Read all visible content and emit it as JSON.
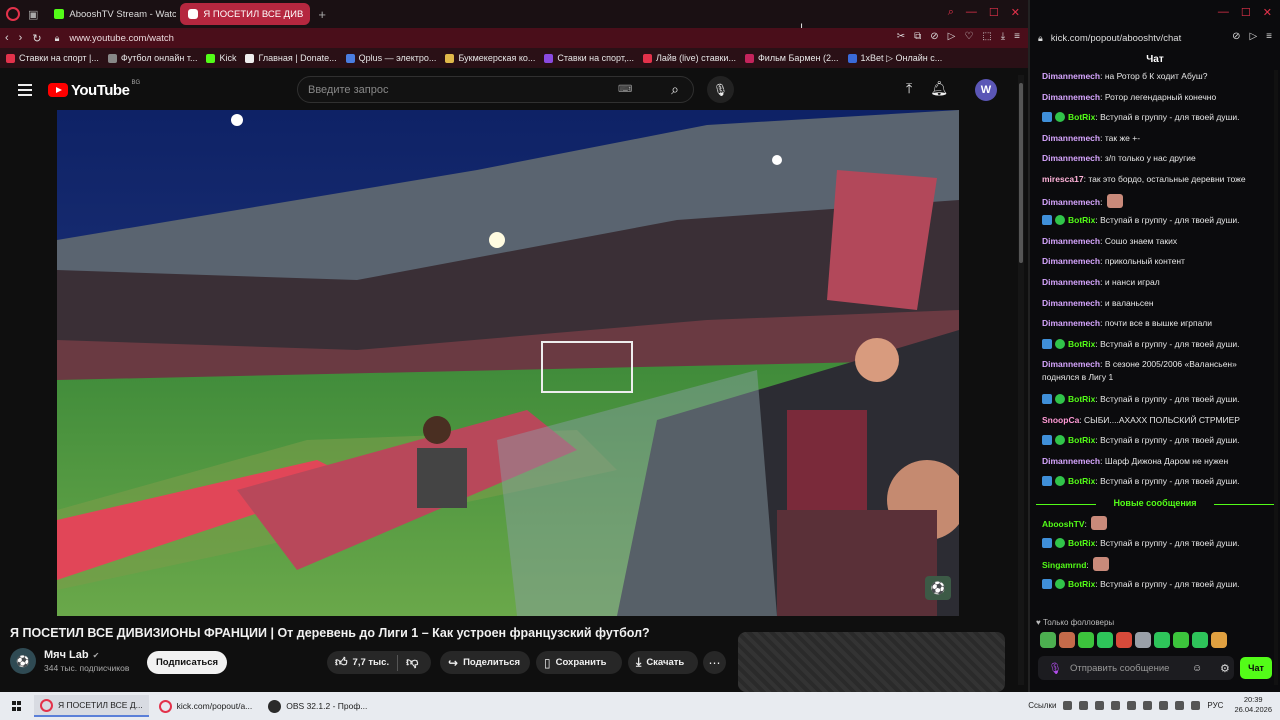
{
  "browser": {
    "tabs": [
      {
        "label": "AbooshTV Stream - Watch",
        "active": false,
        "color": "#53fc18"
      },
      {
        "label": "Я ПОСЕТИЛ ВСЕ ДИВ",
        "active": true,
        "color": "#ff0000"
      }
    ],
    "url": "www.youtube.com/watch",
    "bookmarks": [
      {
        "label": "Ставки на спорт |...",
        "color": "#e3324b"
      },
      {
        "label": "Футбол онлайн т...",
        "color": "#888888"
      },
      {
        "label": "Kick",
        "color": "#53fc18"
      },
      {
        "label": "Главная | Donate...",
        "color": "#eeeeee"
      },
      {
        "label": "Qplus — электро...",
        "color": "#4a7de0"
      },
      {
        "label": "Букмекерская ко...",
        "color": "#e0b84a"
      },
      {
        "label": "Ставки на спорт,...",
        "color": "#8a4ae0"
      },
      {
        "label": "Лайв (live) ставки...",
        "color": "#e3324b"
      },
      {
        "label": "Фильм Бармен (2...",
        "color": "#c4245c"
      },
      {
        "label": "1xBet ▷ Онлайн с...",
        "color": "#3a6ad8"
      }
    ]
  },
  "youtube": {
    "logo_text": "YouTube",
    "country_code": "BG",
    "search_placeholder": "Введите запрос",
    "avatar_letter": "W",
    "video_title": "Я ПОСЕТИЛ ВСЕ ДИВИЗИОНЫ ФРАНЦИИ | От деревень до Лиги 1 – Как устроен французский футбол?",
    "channel_name": "Мяч Lab",
    "channel_subs": "344 тыс. подписчиков",
    "subscribe_label": "Подписаться",
    "likes": "7,7 тыс.",
    "share_label": "Поделиться",
    "save_label": "Сохранить",
    "download_label": "Скачать"
  },
  "kick": {
    "url": "kick.com/popout/abooshtv/chat",
    "chat_title": "Чат",
    "messages": [
      {
        "user": "Dimannemech",
        "color": "#d7a6ff",
        "text": "на Ротор б К ходит Абуш?",
        "badges": false
      },
      {
        "user": "Dimannemech",
        "color": "#d7a6ff",
        "text": "Ротор легендарный конечно",
        "badges": false
      },
      {
        "user": "BotRix",
        "color": "#53fc18",
        "text": "Вступай в группу - для твоей души.",
        "badges": true
      },
      {
        "user": "Dimannemech",
        "color": "#d7a6ff",
        "text": "так же +-",
        "badges": false
      },
      {
        "user": "Dimannemech",
        "color": "#d7a6ff",
        "text": "з/п только у нас другие",
        "badges": false
      },
      {
        "user": "miresca17",
        "color": "#ffb3d9",
        "text": "так это бордо, остальные деревни тоже",
        "badges": false
      },
      {
        "user": "Dimannemech",
        "color": "#d7a6ff",
        "text": "",
        "badges": false
      },
      {
        "user": "BotRix",
        "color": "#53fc18",
        "text": "Вступай в группу - для твоей души.",
        "badges": true
      },
      {
        "user": "Dimannemech",
        "color": "#d7a6ff",
        "text": "Сошо знаем таких",
        "badges": false
      },
      {
        "user": "Dimannemech",
        "color": "#d7a6ff",
        "text": "прикольный контент",
        "badges": false
      },
      {
        "user": "Dimannemech",
        "color": "#d7a6ff",
        "text": "и нанси играл",
        "badges": false
      },
      {
        "user": "Dimannemech",
        "color": "#d7a6ff",
        "text": "и валаньсен",
        "badges": false
      },
      {
        "user": "Dimannemech",
        "color": "#d7a6ff",
        "text": "почти все в вышке игрпали",
        "badges": false
      },
      {
        "user": "BotRix",
        "color": "#53fc18",
        "text": "Вступай в группу - для твоей души.",
        "badges": true
      },
      {
        "user": "Dimannemech",
        "color": "#d7a6ff",
        "text": "В сезоне 2005/2006 «Валансьен» поднялся в Лигу 1",
        "badges": false
      },
      {
        "user": "BotRix",
        "color": "#53fc18",
        "text": "Вступай в группу - для твоей души.",
        "badges": true
      },
      {
        "user": "SnoopCa",
        "color": "#ff9ad5",
        "text": "СЫБИ....АХАХХ ПОЛЬСКИЙ СТРМИЕР",
        "badges": false
      },
      {
        "user": "BotRix",
        "color": "#53fc18",
        "text": "Вступай в группу - для твоей души.",
        "badges": true
      },
      {
        "user": "Dimannemech",
        "color": "#d7a6ff",
        "text": "Шарф Дижона Даром не нужен",
        "badges": false
      },
      {
        "user": "BotRix",
        "color": "#53fc18",
        "text": "Вступай в группу - для твоей души.",
        "badges": true
      }
    ],
    "new_messages_label": "Новые сообщения",
    "new_messages": [
      {
        "user": "AbooshTV",
        "color": "#53fc18",
        "text": "",
        "badges": false
      },
      {
        "user": "BotRix",
        "color": "#53fc18",
        "text": "Вступай в группу - для твоей души.",
        "badges": true
      },
      {
        "user": "Singamrnd",
        "color": "#53fc18",
        "text": "",
        "badges": false
      },
      {
        "user": "BotRix",
        "color": "#53fc18",
        "text": "Вступай в группу - для твоей души.",
        "badges": true
      }
    ],
    "followers_label": "Только фолловеры",
    "input_placeholder": "Отправить сообщение",
    "send_label": "Чат"
  },
  "taskbar": {
    "items": [
      {
        "label": "Я ПОСЕТИЛ ВСЕ Д..."
      },
      {
        "label": "kick.com/popout/a..."
      },
      {
        "label": "OBS 32.1.2 - Проф..."
      }
    ],
    "tray_label": "Ссылки",
    "lang": "РУС",
    "time": "20:39",
    "date": "26.04.2026"
  }
}
